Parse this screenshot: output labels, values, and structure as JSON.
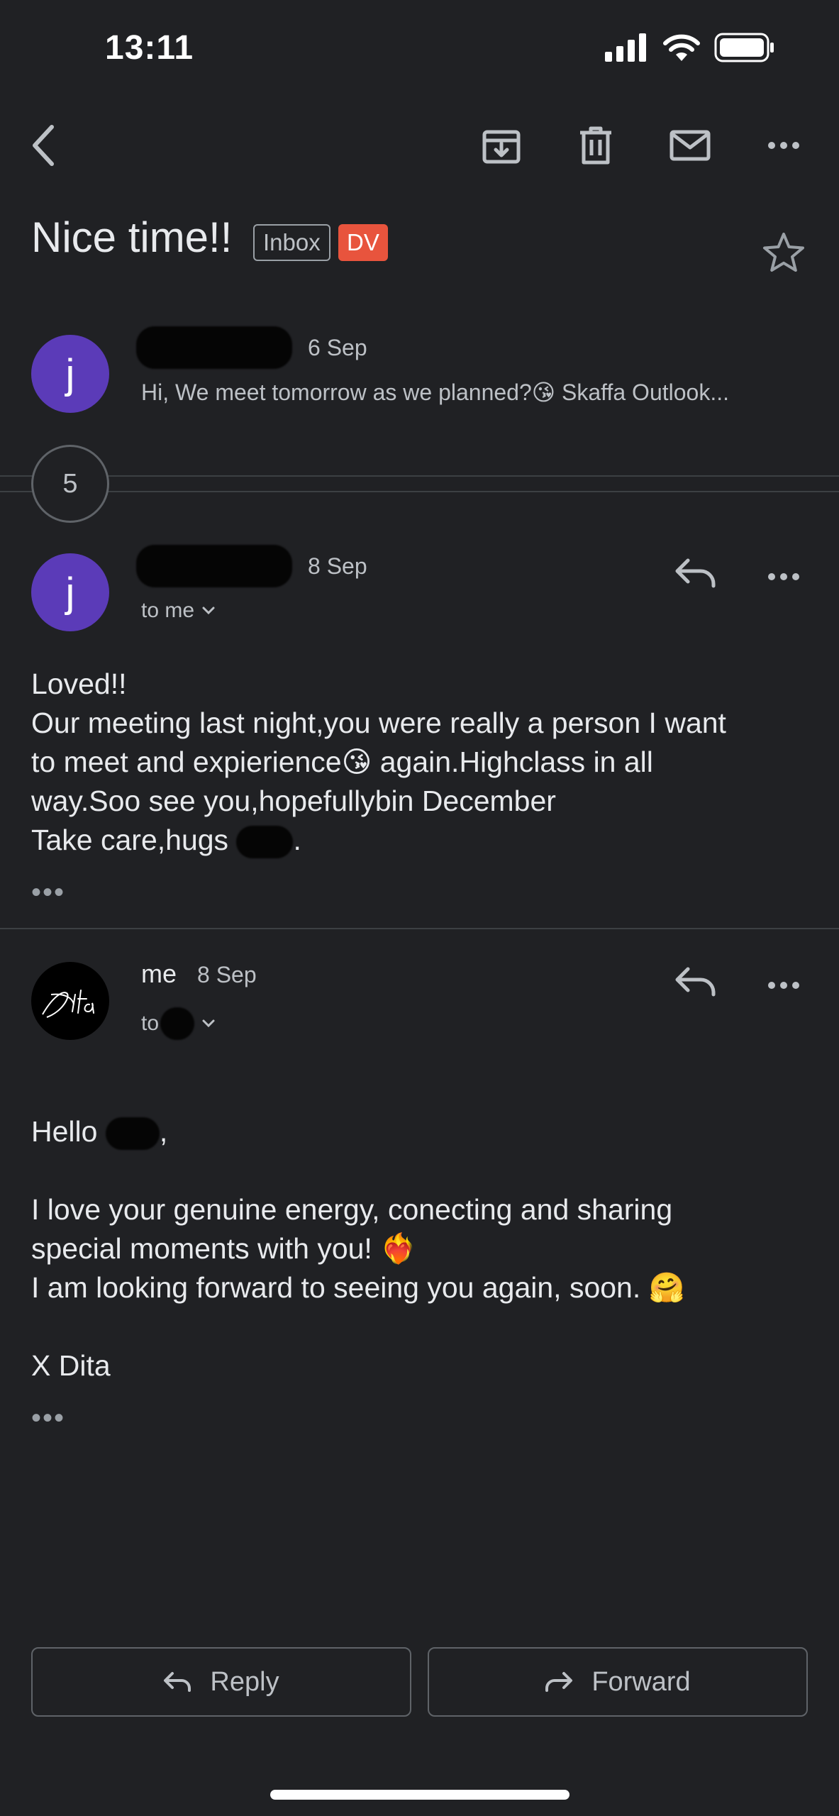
{
  "status_bar": {
    "time": "13:11"
  },
  "toolbar": {
    "back_icon": "chevron-left-icon",
    "archive_icon": "archive-icon",
    "delete_icon": "trash-icon",
    "mark_unread_icon": "mail-icon",
    "more_icon": "more-horizontal-icon"
  },
  "thread": {
    "subject": "Nice time!!",
    "labels": [
      {
        "text": "Inbox",
        "color": "#9aa0a6"
      },
      {
        "text": "DV",
        "color": "#e8543d"
      }
    ],
    "collapsed_count": "5"
  },
  "messages": [
    {
      "avatar_letter": "j",
      "avatar_color": "#5b3bb8",
      "date": "6 Sep",
      "snippet": "Hi, We meet tomorrow as we planned?😘 Skaffa Outlook..."
    },
    {
      "avatar_letter": "j",
      "avatar_color": "#5b3bb8",
      "date": "8 Sep",
      "recipient": "to me",
      "body_lines": [
        "Loved!!",
        "Our meeting last night,you were really a person I want",
        "to meet and expierience😘 again.Highclass in all",
        "way.Soo see you,hopefullybin December"
      ],
      "closing_prefix": "Take care,hugs",
      "closing_suffix": "."
    },
    {
      "sender": "me",
      "avatar_text": "Dita",
      "date": "8 Sep",
      "recipient_prefix": "to",
      "greeting_prefix": "Hello",
      "greeting_suffix": ",",
      "body_lines": [
        "I love your genuine energy, conecting and sharing",
        "special moments with you! ❤️‍🔥",
        "I am looking forward to seeing you again, soon. 🤗"
      ],
      "signature": "X Dita"
    }
  ],
  "quoted_text_toggle": "•••",
  "actions": {
    "reply_label": "Reply",
    "forward_label": "Forward"
  }
}
